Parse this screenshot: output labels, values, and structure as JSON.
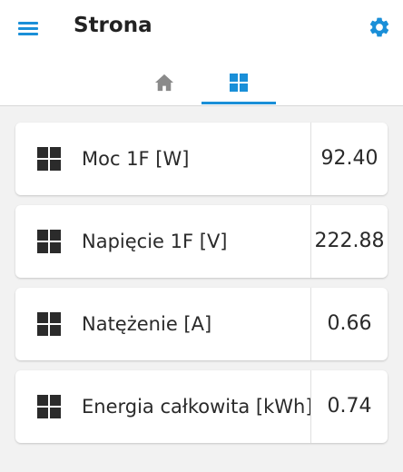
{
  "header": {
    "title": "Strona",
    "menu_icon": "hamburger-menu-icon",
    "settings_icon": "gear-icon",
    "accent_color": "#1a8fd8"
  },
  "tabs": [
    {
      "icon": "home-icon",
      "active": false
    },
    {
      "icon": "grid-icon",
      "active": true
    }
  ],
  "cards": [
    {
      "icon": "grid-icon",
      "label": "Moc 1F [W]",
      "value": "92.40"
    },
    {
      "icon": "grid-icon",
      "label": "Napięcie 1F [V]",
      "value": "222.88"
    },
    {
      "icon": "grid-icon",
      "label": "Natężenie [A]",
      "value": "0.66"
    },
    {
      "icon": "grid-icon",
      "label": "Energia całkowita [kWh]",
      "value": "0.74"
    }
  ]
}
